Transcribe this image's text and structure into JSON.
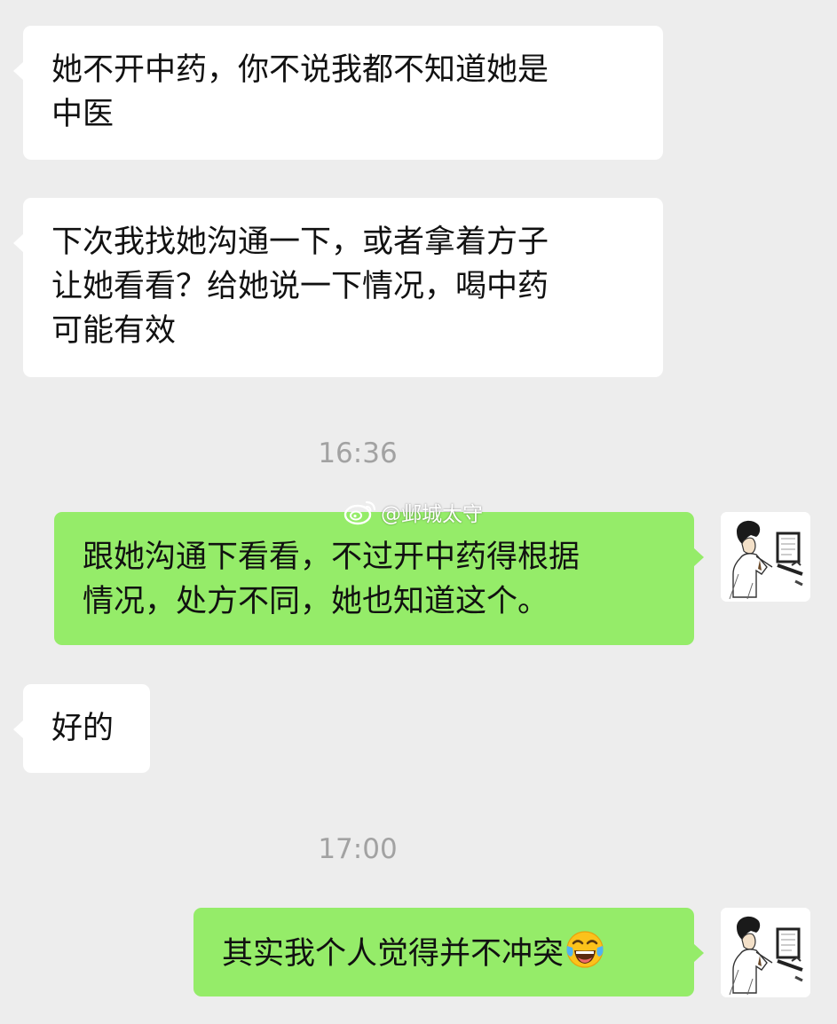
{
  "messages": [
    {
      "side": "in",
      "lines": [
        "她不开中药，你不说我都不知道她是",
        "中医"
      ]
    },
    {
      "side": "in",
      "lines": [
        "下次我找她沟通一下，或者拿着方子",
        "让她看看？给她说一下情况，喝中药",
        "可能有效"
      ]
    },
    {
      "timestamp": "16:36"
    },
    {
      "side": "out",
      "lines": [
        "跟她沟通下看看，不过开中药得根据",
        "情况，处方不同，她也知道这个。"
      ]
    },
    {
      "side": "in",
      "lines": [
        "好的"
      ]
    },
    {
      "timestamp": "17:00"
    },
    {
      "side": "out",
      "lines": [
        "其实我个人觉得并不冲突"
      ],
      "emoji": "tears-of-joy-emoji"
    }
  ],
  "watermark": {
    "text": "@邺城太守",
    "icon": "weibo-logo-icon"
  },
  "colors": {
    "background": "#ededed",
    "incoming_bubble": "#ffffff",
    "outgoing_bubble": "#95ec69",
    "timestamp_text": "#a2a2a2"
  }
}
